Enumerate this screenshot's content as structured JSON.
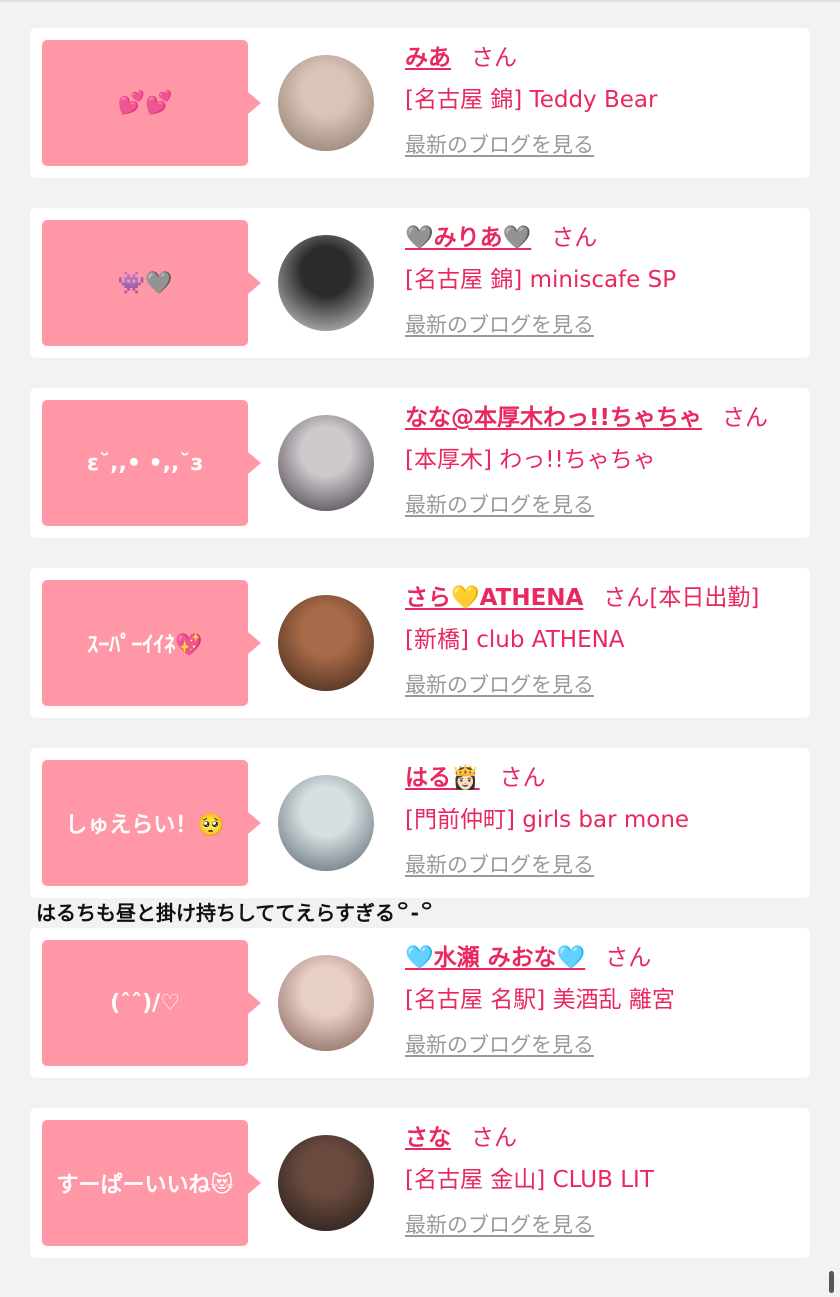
{
  "cards": [
    {
      "bubble": "💕💕",
      "name": "みあ",
      "san": "さん",
      "shop": "[名古屋 錦] Teddy Bear",
      "blog": "最新のブログを見る",
      "avatar_colors": [
        "#d8c4b8",
        "#8a7468"
      ]
    },
    {
      "bubble": "👾🩶",
      "name": "🩶みりあ🩶",
      "san": "さん",
      "shop": "[名古屋 錦] miniscafe SP",
      "blog": "最新のブログを見る",
      "avatar_colors": [
        "#2b2b2b",
        "#d9d9d9"
      ]
    },
    {
      "bubble": "ε˘,,• •,,˘з",
      "name": "なな@本厚木わっ!!ちゃちゃ",
      "san": "さん",
      "shop": "[本厚木] わっ!!ちゃちゃ",
      "blog": "最新のブログを見る",
      "avatar_colors": [
        "#cfc8cc",
        "#3b3440"
      ]
    },
    {
      "bubble": "ｽｰﾊﾟｰｲｲﾈ💖",
      "name": "さら💛ATHENA",
      "san": "さん[本日出勤]",
      "shop": "[新橋] club ATHENA",
      "blog": "最新のブログを見る",
      "avatar_colors": [
        "#a86a48",
        "#3a2418"
      ]
    },
    {
      "bubble": "しゅえらい！🥺",
      "name": "はる👸🏻",
      "san": "さん",
      "shop": "[門前仲町] girls bar mone",
      "blog": "最新のブログを見る",
      "avatar_colors": [
        "#d6e0e2",
        "#54606a"
      ]
    },
    {
      "bubble": "(ˆˆ)/♡",
      "name": "🩵水瀬 みおな🩵",
      "san": "さん",
      "shop": "[名古屋 名駅] 美酒乱 離宮",
      "blog": "最新のブログを見る",
      "avatar_colors": [
        "#e8cfc6",
        "#7a5a50"
      ]
    },
    {
      "bubble": "すーぱーいいね😻",
      "name": "さな",
      "san": "さん",
      "shop": "[名古屋 金山] CLUB LIT",
      "blog": "最新のブログを見る",
      "avatar_colors": [
        "#6a4a3e",
        "#1e1a18"
      ]
    }
  ],
  "caption": "はるちも昼と掛け持ちしててえらすぎる꒪-꒪"
}
